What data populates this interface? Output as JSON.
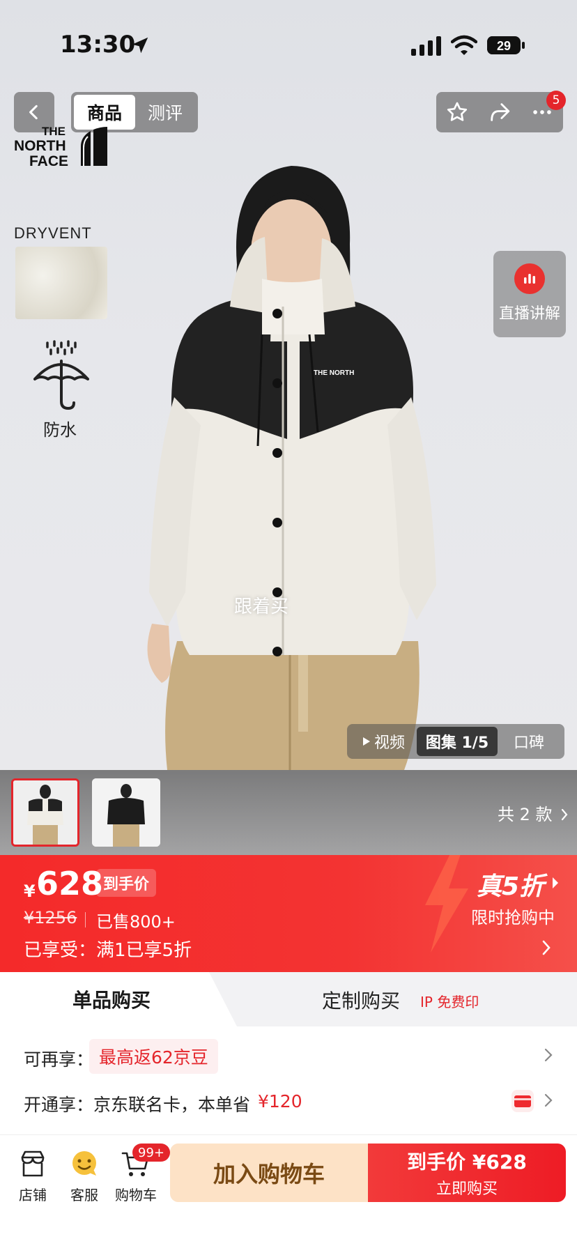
{
  "status_bar": {
    "time": "13:30",
    "battery": "29"
  },
  "header": {
    "tabs": [
      {
        "label": "商品"
      },
      {
        "label": "测评"
      }
    ],
    "cart_count": "5"
  },
  "brand": {
    "logo_text": [
      "THE",
      "NORTH",
      "FACE"
    ]
  },
  "features": {
    "dryvent": "DRYVENT",
    "waterproof": "防水"
  },
  "live": {
    "label": "直播讲解"
  },
  "overlay": {
    "follow_buy": "跟着买"
  },
  "media_tabs": {
    "video": "视频",
    "gallery": "图集 1/5",
    "review": "口碑"
  },
  "variants": {
    "count_label": "共 2 款"
  },
  "price": {
    "currency": "¥",
    "value": "628",
    "tag": "到手价",
    "original": "¥1256",
    "sold": "已售800+",
    "enjoyed": "已享受：满1已享5折",
    "discount": "真5折",
    "flash": "限时抢购中"
  },
  "purchase": {
    "single": "单品购买",
    "custom": "定制购买",
    "ip_free": "IP 免费印"
  },
  "benefits": {
    "row1_label": "可再享：",
    "jd_beans": "最高返62京豆",
    "row2_label": "开通享：",
    "card_text": "京东联名卡，本单省",
    "save_amount": "¥120"
  },
  "bottom_nav": {
    "store": "店铺",
    "service": "客服",
    "cart": "购物车",
    "cart_badge": "99+",
    "add_to_cart": "加入购物车",
    "buy_top": "到手价 ¥628",
    "buy_bottom": "立即购买"
  },
  "colors": {
    "accent_red": "#e4252b",
    "add_cart_bg": "#fde2c6"
  }
}
